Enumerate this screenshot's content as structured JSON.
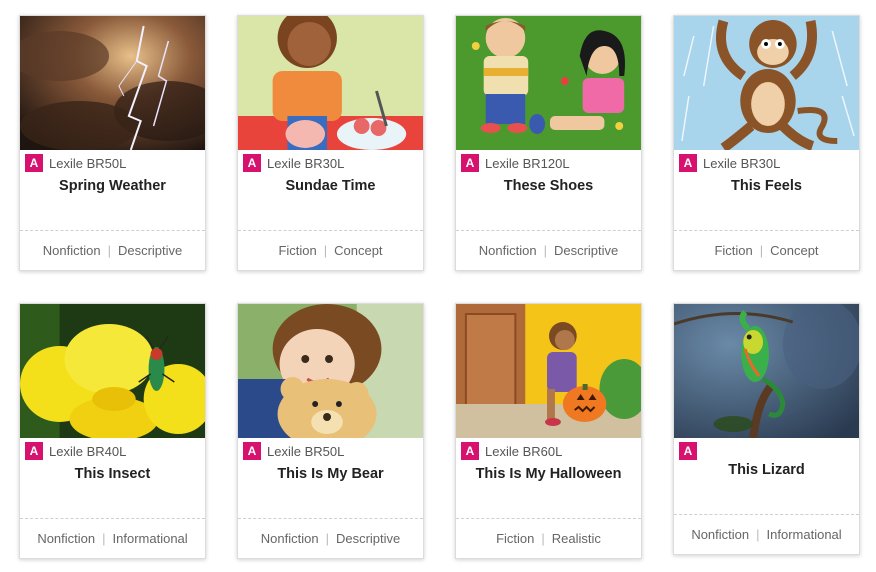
{
  "books": [
    {
      "level": "A",
      "lexile": "Lexile BR50L",
      "title": "Spring Weather",
      "genre": "Nonfiction",
      "type": "Descriptive",
      "image": "lightning-storm"
    },
    {
      "level": "A",
      "lexile": "Lexile BR30L",
      "title": "Sundae Time",
      "genre": "Fiction",
      "type": "Concept",
      "image": "girl-making-sundae"
    },
    {
      "level": "A",
      "lexile": "Lexile BR120L",
      "title": "These Shoes",
      "genre": "Nonfiction",
      "type": "Descriptive",
      "image": "kids-on-grass"
    },
    {
      "level": "A",
      "lexile": "Lexile BR30L",
      "title": "This Feels",
      "genre": "Fiction",
      "type": "Concept",
      "image": "dancing-monkey"
    },
    {
      "level": "A",
      "lexile": "Lexile BR40L",
      "title": "This Insect",
      "genre": "Nonfiction",
      "type": "Informational",
      "image": "beetle-on-flower"
    },
    {
      "level": "A",
      "lexile": "Lexile BR50L",
      "title": "This Is My Bear",
      "genre": "Nonfiction",
      "type": "Descriptive",
      "image": "girl-with-teddy-bear"
    },
    {
      "level": "A",
      "lexile": "Lexile BR60L",
      "title": "This Is My Halloween",
      "genre": "Fiction",
      "type": "Realistic",
      "image": "girl-with-pumpkin"
    },
    {
      "level": "A",
      "lexile": "",
      "title": "This Lizard",
      "genre": "Nonfiction",
      "type": "Informational",
      "image": "chameleon"
    }
  ],
  "colors": {
    "level_badge": "#d6116e"
  }
}
